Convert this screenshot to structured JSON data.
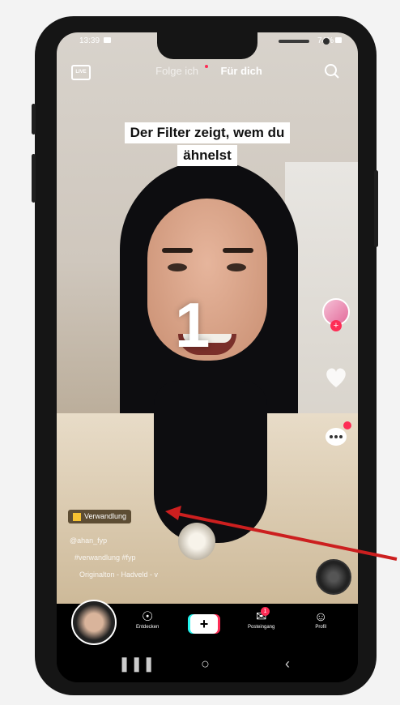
{
  "status": {
    "time": "13:39",
    "battery": "74%"
  },
  "top_tabs": {
    "following": "Folge ich",
    "for_you": "Für dich"
  },
  "icons": {
    "live": "LIVE",
    "search": "search-icon"
  },
  "overlay": {
    "line1": "Der Filter zeigt, wem du",
    "line2": "ähnelst",
    "countdown": "1"
  },
  "effect_label": "Verwandlung",
  "meta": {
    "username": "@ahan_fyp",
    "hashtags": "#verwandlung #fyp",
    "sound": "Originalton - Hadveld - v"
  },
  "nav": {
    "discover": "Entdecken",
    "inbox": "Posteingang",
    "profile": "Profil",
    "inbox_badge": "1"
  },
  "colors": {
    "accent": "#fe2c55",
    "cyan": "#25f4ee",
    "arrow": "#cc1f1f"
  }
}
